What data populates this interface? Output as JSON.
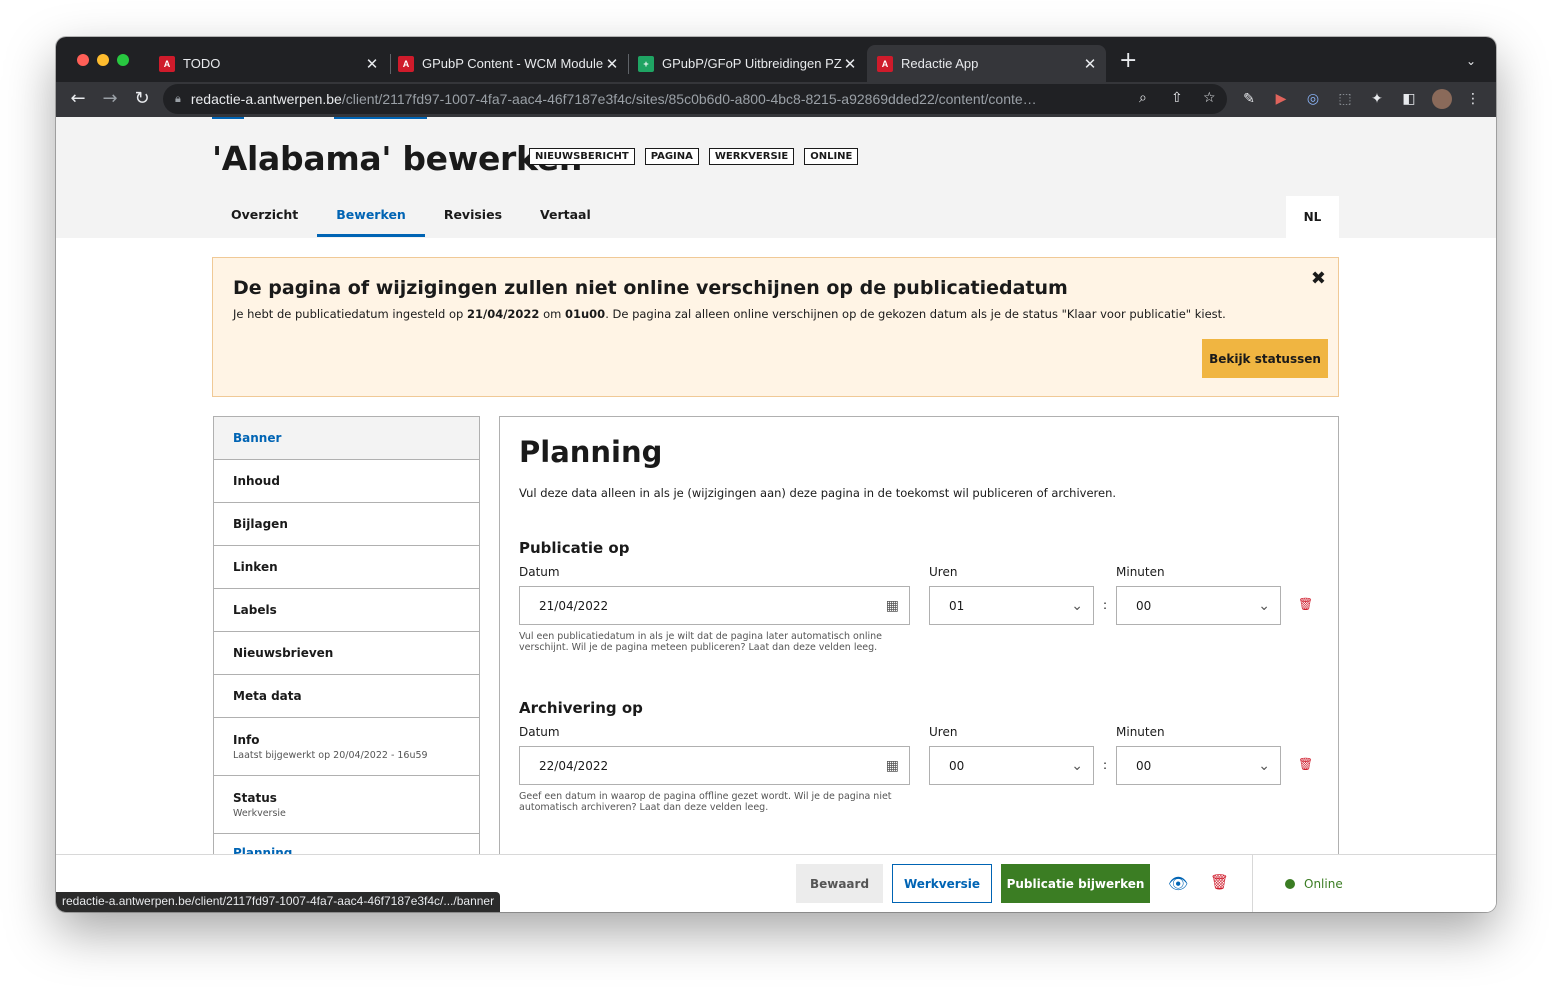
{
  "browser": {
    "tabs": [
      {
        "title": "TODO",
        "favicon": "antwerpen-logo-icon"
      },
      {
        "title": "GPubP Content - WCM Module",
        "favicon": "antwerpen-logo-icon"
      },
      {
        "title": "GPubP/GFoP Uitbreidingen PZA",
        "favicon": "sheets-icon"
      },
      {
        "title": "Redactie App",
        "favicon": "antwerpen-logo-icon"
      }
    ],
    "url_domain": "redactie-a.antwerpen.be",
    "url_path": "/client/2117fd97-1007-4fa7-aac4-46f7187e3f4c/sites/85c0b6d0-a800-4bc8-8215-a92869dded22/content/conte…",
    "status_url": "redactie-a.antwerpen.be/client/2117fd97-1007-4fa7-aac4-46f7187e3f4c/.../banner"
  },
  "header": {
    "title": "'Alabama' bewerken",
    "tags": [
      "NIEUWSBERICHT",
      "PAGINA",
      "WERKVERSIE",
      "ONLINE"
    ],
    "tabs": [
      "Overzicht",
      "Bewerken",
      "Revisies",
      "Vertaal"
    ],
    "active_tab": "Bewerken",
    "language": "NL"
  },
  "alert": {
    "title": "De pagina of wijzigingen zullen niet online verschijnen op de publicatiedatum",
    "text_1": "Je hebt de publicatiedatum ingesteld op ",
    "date": "21/04/2022",
    "text_2": " om ",
    "time": "01u00",
    "text_3": ". De pagina zal alleen online verschijnen op de gekozen datum als je de status \"Klaar voor publicatie\" kiest.",
    "button": "Bekijk statussen"
  },
  "sidenav": {
    "items": [
      {
        "label": "Banner",
        "sub": ""
      },
      {
        "label": "Inhoud",
        "sub": ""
      },
      {
        "label": "Bijlagen",
        "sub": ""
      },
      {
        "label": "Linken",
        "sub": ""
      },
      {
        "label": "Labels",
        "sub": ""
      },
      {
        "label": "Nieuwsbrieven",
        "sub": ""
      },
      {
        "label": "Meta data",
        "sub": ""
      },
      {
        "label": "Info",
        "sub": "Laatst bijgewerkt op 20/04/2022 - 16u59"
      },
      {
        "label": "Status",
        "sub": "Werkversie"
      },
      {
        "label": "Planning",
        "sub": ""
      }
    ]
  },
  "planning": {
    "title": "Planning",
    "intro": "Vul deze data alleen in als je (wijzigingen aan) deze pagina in de toekomst wil publiceren of archiveren.",
    "labels": {
      "date": "Datum",
      "hours": "Uren",
      "minutes": "Minuten"
    },
    "publication": {
      "title": "Publicatie op",
      "date": "21/04/2022",
      "hours": "01",
      "minutes": "00",
      "hint": "Vul een publicatiedatum in als je wilt dat de pagina later automatisch online verschijnt. Wil je de pagina meteen publiceren? Laat dan deze velden leeg."
    },
    "archive": {
      "title": "Archivering op",
      "date": "22/04/2022",
      "hours": "00",
      "minutes": "00",
      "hint": "Geef een datum in waarop de pagina offline gezet wordt. Wil je de pagina niet automatisch archiveren? Laat dan deze velden leeg."
    }
  },
  "footer": {
    "saved": "Bewaard",
    "draft": "Werkversie",
    "publish": "Publicatie bijwerken",
    "status": "Online"
  },
  "colors": {
    "primary": "#0064b4",
    "publish_green": "#3b7d23",
    "warning_bg": "#fff4e5",
    "warning_button": "#f0b541",
    "danger": "#cf1b2b"
  }
}
